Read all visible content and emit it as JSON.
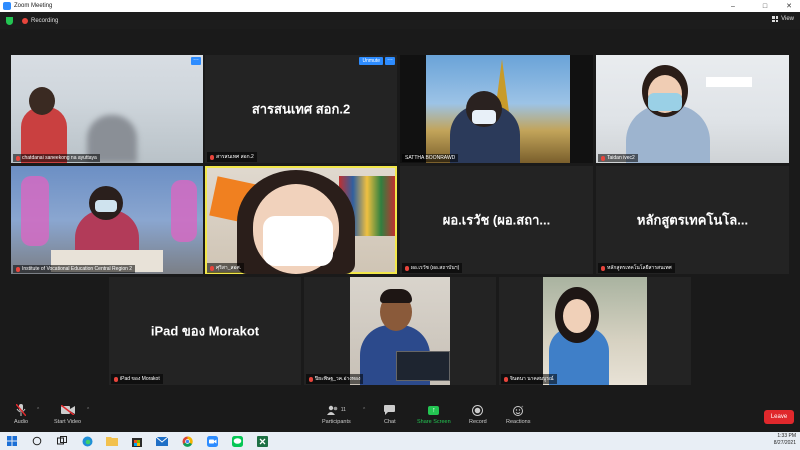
{
  "window": {
    "title": "Zoom Meeting"
  },
  "meeting": {
    "recording_label": "Recording",
    "view_label": "View"
  },
  "tiles": [
    {
      "name": "chatdanai saneekong na ayuttaya",
      "display_text": ""
    },
    {
      "name": "สารสนเทศ สอก.2",
      "display_text": "สารสนเทศ สอก.2",
      "unmute_label": "Unmute"
    },
    {
      "name": "SATTHA BOONRAWD",
      "display_text": ""
    },
    {
      "name": "Taidan ivec2",
      "display_text": ""
    },
    {
      "name": "Institute of Vocational Education Central Region 2",
      "display_text": ""
    },
    {
      "name": "ศุริสา_สอศ.",
      "display_text": ""
    },
    {
      "name": "ผอ.เรวัช (ผอ.สถาบันฯ)",
      "display_text": "ผอ.เรวัช (ผอ.สถา..."
    },
    {
      "name": "หลักสูตรเทคโนโลยีสารสนเทศ",
      "display_text": "หลักสูตรเทคโนโล..."
    },
    {
      "name": "iPad ของ Morakot",
      "display_text": "iPad ของ Morakot"
    },
    {
      "name": "ปิยะพิษฐ_วค.อ่างทอง",
      "display_text": ""
    },
    {
      "name": "จินตนา นาคสมบูรณ์",
      "display_text": ""
    }
  ],
  "toolbar": {
    "audio": "Audio",
    "start_video": "Start Video",
    "participants": "Participants",
    "participants_count": "11",
    "chat": "Chat",
    "share_screen": "Share Screen",
    "record": "Record",
    "reactions": "Reactions",
    "leave": "Leave"
  },
  "taskbar": {
    "time": "1:33 PM",
    "date": "8/27/2021"
  },
  "colors": {
    "accent": "#2d8cff",
    "share_green": "#23c552",
    "leave_red": "#e0282c",
    "active_speaker": "#f2e74a"
  }
}
